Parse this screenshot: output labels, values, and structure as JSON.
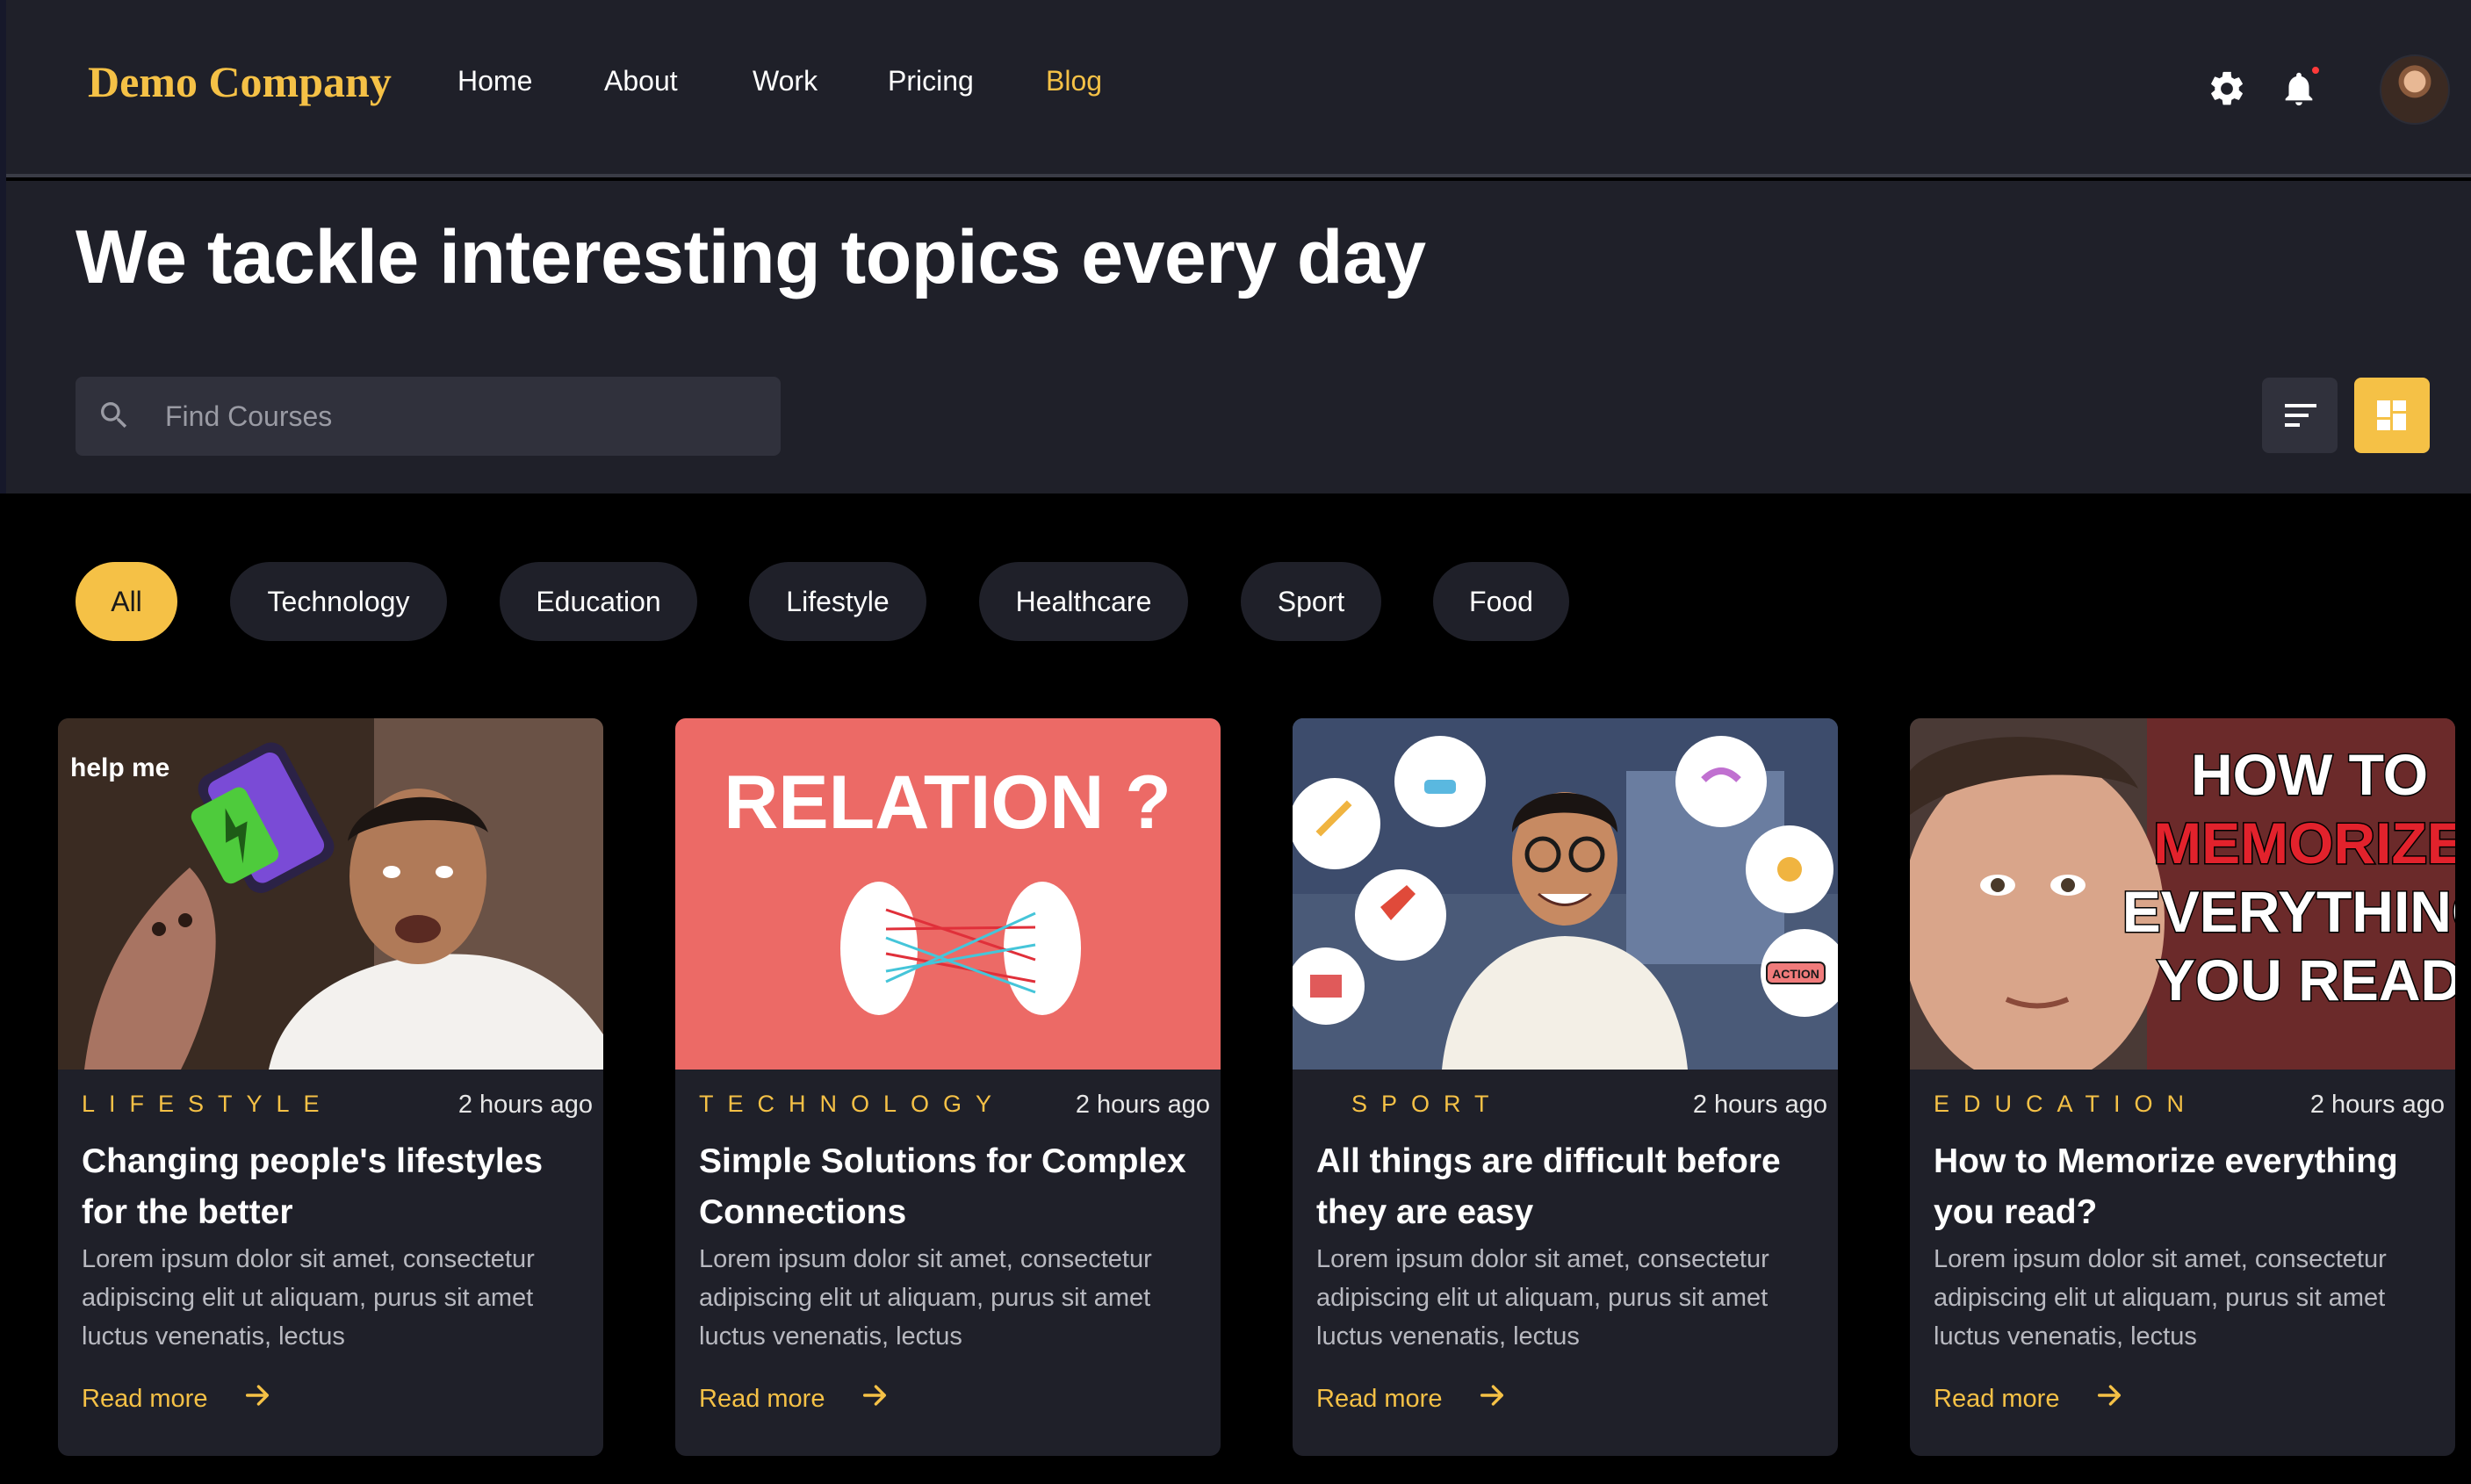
{
  "brand": "Demo Company",
  "nav": [
    {
      "label": "Home",
      "active": false
    },
    {
      "label": "About",
      "active": false
    },
    {
      "label": "Work",
      "active": false
    },
    {
      "label": "Pricing",
      "active": false
    },
    {
      "label": "Blog",
      "active": true
    }
  ],
  "header_icons": [
    "gear-icon",
    "bell-icon",
    "avatar"
  ],
  "hero": {
    "title": "We tackle interesting topics every day"
  },
  "search": {
    "placeholder": "Find Courses",
    "value": ""
  },
  "view_toggle": {
    "options": [
      "list-view",
      "grid-view"
    ],
    "selected": "grid-view"
  },
  "filters": [
    {
      "label": "All",
      "active": true
    },
    {
      "label": "Technology",
      "active": false
    },
    {
      "label": "Education",
      "active": false
    },
    {
      "label": "Lifestyle",
      "active": false
    },
    {
      "label": "Healthcare",
      "active": false
    },
    {
      "label": "Sport",
      "active": false
    },
    {
      "label": "Food",
      "active": false
    }
  ],
  "cards": [
    {
      "category": "LIFESTYLE",
      "time": "2 hours ago",
      "title": "Changing people's lifestyles for the better",
      "excerpt": "Lorem ipsum dolor sit amet, consectetur adipiscing elit ut aliquam, purus sit amet luctus venenatis, lectus",
      "read_more": "Read more",
      "thumb_text": "help me"
    },
    {
      "category": "TECHNOLOGY",
      "time": "2 hours ago",
      "title": "Simple Solutions for Complex Connections",
      "excerpt": "Lorem ipsum dolor sit amet, consectetur adipiscing elit ut aliquam, purus sit amet luctus venenatis, lectus",
      "read_more": "Read more",
      "thumb_text": "RELATION ?"
    },
    {
      "category": "SPORT",
      "time": "2 hours ago",
      "title": "All things are difficult before they are easy",
      "excerpt": "Lorem ipsum dolor sit amet, consectetur adipiscing elit ut aliquam, purus sit amet luctus venenatis, lectus",
      "read_more": "Read more",
      "thumb_text": "ACTION"
    },
    {
      "category": "EDUCATION",
      "time": "2 hours ago",
      "title": "How to Memorize everything you read?",
      "excerpt": "Lorem ipsum dolor sit amet, consectetur adipiscing elit ut aliquam, purus sit amet luctus venenatis, lectus",
      "read_more": "Read more",
      "thumb_lines": [
        "HOW TO",
        "MEMORIZE",
        "EVERYTHING",
        "YOU READ"
      ]
    }
  ],
  "colors": {
    "accent": "#f5c146",
    "header_bg": "#1f2029",
    "page_bg": "#000000",
    "card_bg": "#1f2029",
    "input_bg": "#30313c",
    "notification_dot": "#ff3a3a",
    "relation_bg": "#ec6a66"
  }
}
